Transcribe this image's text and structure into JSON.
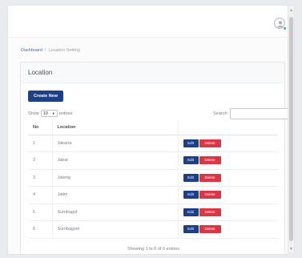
{
  "breadcrumb": {
    "home": "Dashboard",
    "separator": "/",
    "current": "Location Setting"
  },
  "card": {
    "title": "Location"
  },
  "toolbar": {
    "create_label": "Create New"
  },
  "length_menu": {
    "prefix": "Show",
    "selected": "10",
    "suffix": "entries"
  },
  "search": {
    "label": "Search:",
    "value": ""
  },
  "table": {
    "columns": [
      "No",
      "Location"
    ],
    "rows": [
      {
        "no": "1",
        "location": "Jakarta"
      },
      {
        "no": "2",
        "location": "Jabar"
      },
      {
        "no": "3",
        "location": "Jateng"
      },
      {
        "no": "4",
        "location": "Jatim"
      },
      {
        "no": "5",
        "location": "Sumbagut"
      },
      {
        "no": "6",
        "location": "Sumbagsel"
      }
    ],
    "edit_label": "Edit",
    "delete_label": "Delete"
  },
  "footer": {
    "info": "Showing 1 to 6 of 6 entries"
  },
  "colors": {
    "primary": "#1d3f87",
    "danger": "#dc3545",
    "status_online": "#3cb371"
  },
  "icons": {
    "avatar": "user-icon",
    "sort": "caret-down-icon"
  }
}
